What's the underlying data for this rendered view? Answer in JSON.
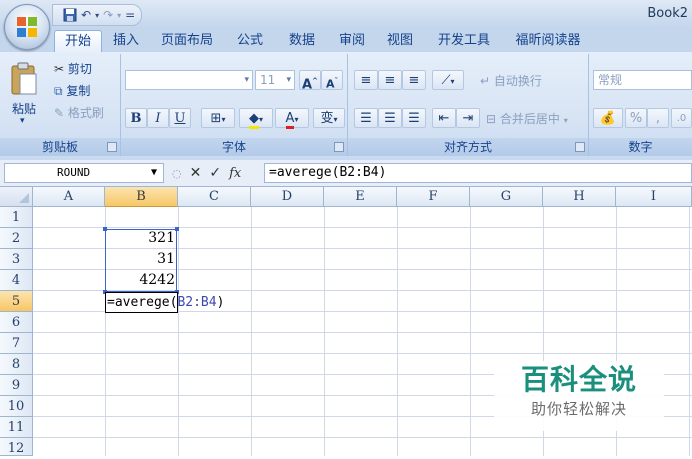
{
  "title_bar": {
    "app_title": "Book2"
  },
  "quick_access": {
    "save_icon": "save-icon",
    "undo_icon": "undo-icon",
    "redo_icon": "redo-icon",
    "customize": "="
  },
  "tabs": [
    {
      "label": "开始",
      "active": true
    },
    {
      "label": "插入"
    },
    {
      "label": "页面布局"
    },
    {
      "label": "公式"
    },
    {
      "label": "数据"
    },
    {
      "label": "审阅"
    },
    {
      "label": "视图"
    },
    {
      "label": "开发工具"
    },
    {
      "label": "福昕阅读器"
    }
  ],
  "ribbon": {
    "clipboard": {
      "paste": "粘贴",
      "cut": "剪切",
      "copy": "复制",
      "format_painter": "格式刷",
      "label": "剪贴板"
    },
    "font": {
      "font_size": "11",
      "bold": "B",
      "italic": "I",
      "underline": "U",
      "label": "字体"
    },
    "alignment": {
      "wrap_text": "自动换行",
      "merge_center": "合并后居中",
      "label": "对齐方式"
    },
    "number": {
      "format": "常规",
      "percent": "%",
      "comma": ",",
      "label": "数字"
    }
  },
  "formula_bar": {
    "name_box": "ROUND",
    "formula": "=averege(B2:B4)"
  },
  "grid": {
    "columns": [
      "A",
      "B",
      "C",
      "D",
      "E",
      "F",
      "G",
      "H",
      "I"
    ],
    "rows": [
      "1",
      "2",
      "3",
      "4",
      "5",
      "6",
      "7",
      "8",
      "9",
      "10",
      "11",
      "12"
    ],
    "selected_column": "B",
    "selected_row": "5",
    "cells": {
      "B2": "321",
      "B3": "31",
      "B4": "4242"
    },
    "editing_cell": {
      "address": "B5",
      "prefix": "=averege(",
      "ref": "B2:B4",
      "suffix": ")"
    }
  },
  "watermark": {
    "title": "百科全说",
    "subtitle": "助你轻松解决"
  }
}
